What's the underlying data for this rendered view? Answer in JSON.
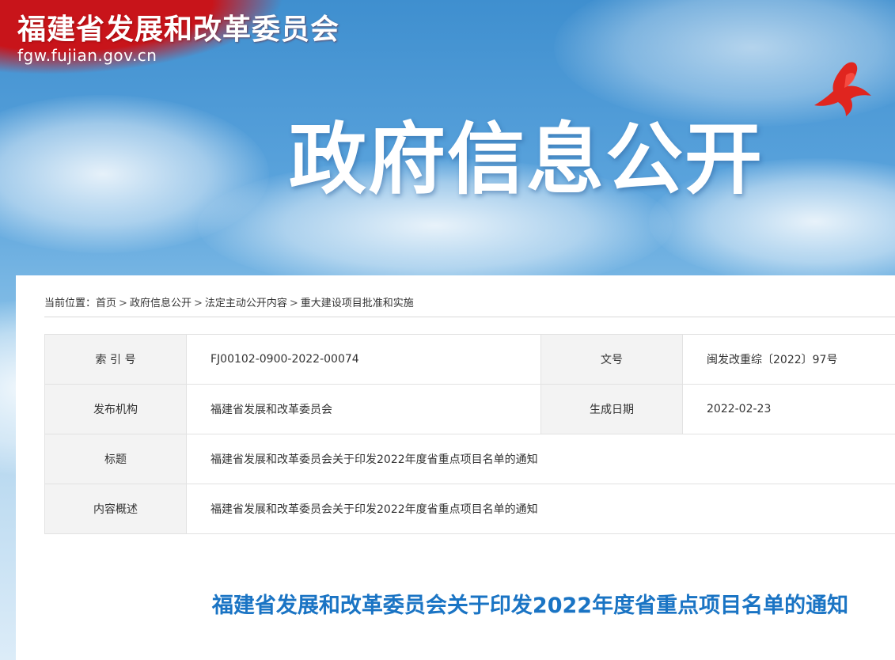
{
  "header": {
    "site_title": "福建省发展和改革委员会",
    "site_domain": "fgw.fujian.gov.cn",
    "banner_title": "政府信息公开"
  },
  "breadcrumb": {
    "prefix": "当前位置：",
    "separator": ">",
    "items": [
      "首页",
      "政府信息公开",
      "法定主动公开内容",
      "重大建设项目批准和实施"
    ]
  },
  "meta": {
    "index_label": "索 引 号",
    "index_value": "FJ00102-0900-2022-00074",
    "doc_no_label": "文号",
    "doc_no_value": "闽发改重综〔2022〕97号",
    "publisher_label": "发布机构",
    "publisher_value": "福建省发展和改革委员会",
    "date_label": "生成日期",
    "date_value": "2022-02-23",
    "title_label": "标题",
    "title_value": "福建省发展和改革委员会关于印发2022年度省重点项目名单的通知",
    "summary_label": "内容概述",
    "summary_value": "福建省发展和改革委员会关于印发2022年度省重点项目名单的通知"
  },
  "article": {
    "title": "福建省发展和改革委员会关于印发2022年度省重点项目名单的通知"
  },
  "colors": {
    "accent_red": "#c8141a",
    "title_blue": "#1a74c4",
    "label_bg": "#f3f3f3"
  }
}
